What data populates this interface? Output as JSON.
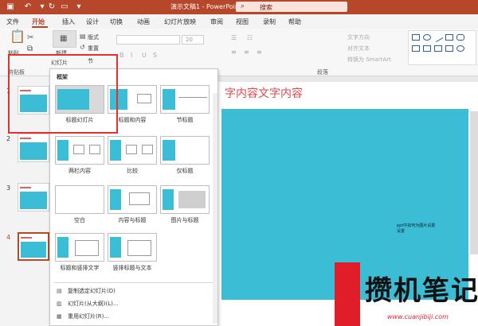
{
  "app": {
    "doc_title": "演示文稿1  -  PowerPoint",
    "search_label": "搜索",
    "accent_color": "#b7472a"
  },
  "tabs": [
    "文件",
    "开始",
    "插入",
    "设计",
    "切换",
    "动画",
    "幻灯片放映",
    "审阅",
    "视图",
    "录制",
    "帮助"
  ],
  "ribbon": {
    "paste": "粘贴",
    "clipboard_group": "剪贴板",
    "new_slide": "新建",
    "slides_label": "幻灯片",
    "layout": "版式",
    "reset": "重置",
    "section": "节",
    "font_size": "20",
    "text_direction": "文字方向",
    "align_text": "对齐文本",
    "smartart": "转换为 SmartArt",
    "paragraph_group": "段落"
  },
  "thumbnails": [
    {
      "num": "1"
    },
    {
      "num": "2"
    },
    {
      "num": "3"
    },
    {
      "num": "4"
    }
  ],
  "slide": {
    "title": "字内容文字内容",
    "caption": "ppt中如何为图片设置",
    "caption2": "设置"
  },
  "layout_panel": {
    "header": "框架",
    "items": [
      {
        "label": "标题幻灯片"
      },
      {
        "label": "标题和内容"
      },
      {
        "label": "节标题"
      },
      {
        "label": "两栏内容"
      },
      {
        "label": "比较"
      },
      {
        "label": "仅标题"
      },
      {
        "label": "空白"
      },
      {
        "label": "内容与标题"
      },
      {
        "label": "图片与标题"
      },
      {
        "label": "标题和竖排文字"
      },
      {
        "label": "竖排标题与文本"
      }
    ],
    "commands": [
      {
        "label": "复制选定幻灯片(D)"
      },
      {
        "label": "幻灯片(从大纲)(L)..."
      },
      {
        "label": "重用幻灯片(R)..."
      }
    ]
  },
  "watermark": {
    "text": "攒机笔记",
    "url": "www.cuanjibiji.com"
  }
}
